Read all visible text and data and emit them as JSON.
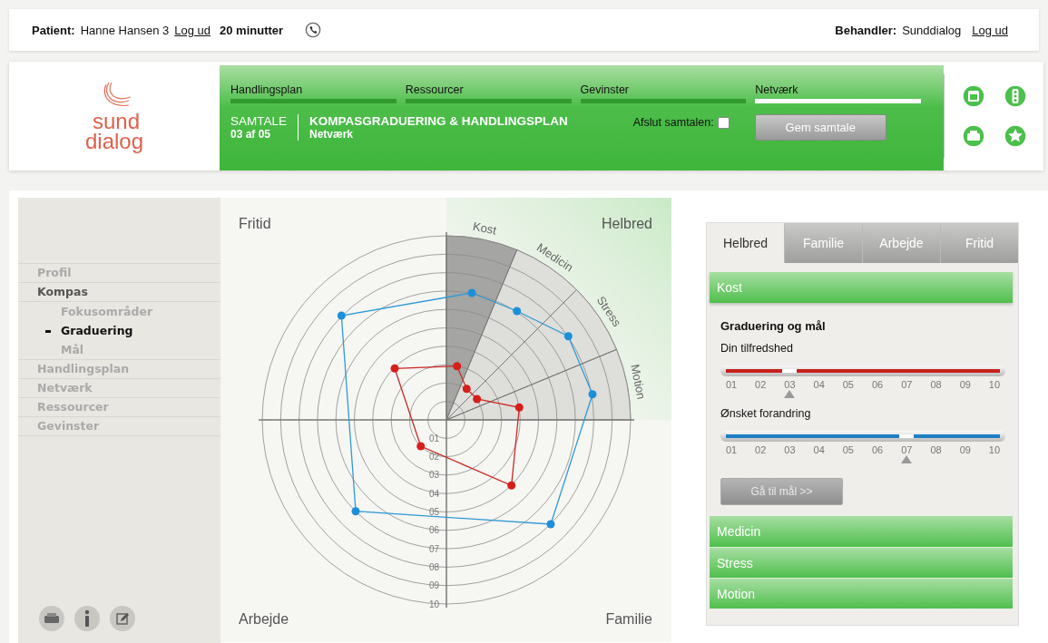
{
  "top_bar": {
    "patient_label": "Patient:",
    "patient_name": "Hanne Hansen 3",
    "patient_logout": "Log ud",
    "duration": "20 minutter",
    "therapist_label": "Behandler:",
    "therapist_name": "Sunddialog",
    "therapist_logout": "Log ud"
  },
  "logo": {
    "line1": "sund",
    "line2": "dialog"
  },
  "nav": [
    {
      "label": "Handlingsplan",
      "selected": false
    },
    {
      "label": "Ressourcer",
      "selected": false
    },
    {
      "label": "Gevinster",
      "selected": false
    },
    {
      "label": "Netværk",
      "selected": true
    }
  ],
  "session": {
    "title": "SAMTALE",
    "count": "03 af 05",
    "heading": "KOMPASGRADUERING & HANDLINGSPLAN",
    "subheading": "Netværk",
    "finish_label": "Afslut samtalen:",
    "finish_checked": false,
    "save_button": "Gem samtale"
  },
  "sidebar": {
    "items": [
      {
        "label": "Profil",
        "expanded": false,
        "selected": false
      },
      {
        "label": "Kompas",
        "expanded": true,
        "selected": false,
        "children": [
          {
            "label": "Fokusområder",
            "selected": false
          },
          {
            "label": "Graduering",
            "selected": true
          },
          {
            "label": "Mål",
            "selected": false
          }
        ]
      },
      {
        "label": "Handlingsplan",
        "expanded": false,
        "selected": false
      },
      {
        "label": "Netværk",
        "expanded": false,
        "selected": false
      },
      {
        "label": "Ressourcer",
        "expanded": false,
        "selected": false
      },
      {
        "label": "Gevinster",
        "expanded": false,
        "selected": false
      }
    ]
  },
  "compass": {
    "quadrants": [
      "Fritid",
      "Helbred",
      "Arbejde",
      "Familie"
    ],
    "sectors": [
      {
        "label": "Kost",
        "selected": true
      },
      {
        "label": "Medicin",
        "selected": false
      },
      {
        "label": "Stress",
        "selected": false
      },
      {
        "label": "Motion",
        "selected": false
      }
    ],
    "ticks": [
      "01",
      "02",
      "03",
      "04",
      "05",
      "06",
      "07",
      "08",
      "09",
      "10"
    ]
  },
  "panel": {
    "tabs": [
      {
        "label": "Helbred",
        "selected": true
      },
      {
        "label": "Familie",
        "selected": false
      },
      {
        "label": "Arbejde",
        "selected": false
      },
      {
        "label": "Fritid",
        "selected": false
      }
    ],
    "sections": [
      {
        "label": "Kost",
        "expanded": true
      },
      {
        "label": "Medicin",
        "expanded": false
      },
      {
        "label": "Stress",
        "expanded": false
      },
      {
        "label": "Motion",
        "expanded": false
      }
    ],
    "heading": "Graduering og mål",
    "sliders": [
      {
        "label": "Din tilfredshed",
        "kind": "red",
        "level": 0.222,
        "ticks": [
          "01",
          "02",
          "03",
          "04",
          "05",
          "06",
          "07",
          "08",
          "09",
          "10"
        ]
      },
      {
        "label": "Ønsket forandring",
        "kind": "blue",
        "level": 0.667,
        "ticks": [
          "01",
          "02",
          "03",
          "04",
          "05",
          "06",
          "07",
          "08",
          "09",
          "10"
        ]
      }
    ],
    "goal_button": "Gå til mål >>"
  }
}
